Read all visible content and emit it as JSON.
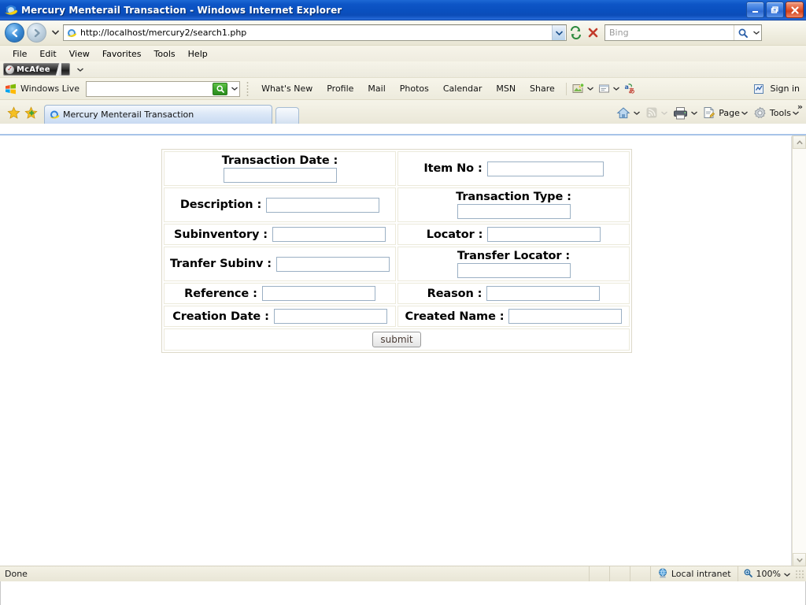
{
  "window": {
    "title": "Mercury Menterail Transaction - Windows Internet Explorer",
    "app_icon": "internet-explorer-icon",
    "buttons": {
      "minimize": "_",
      "restore": "❐",
      "close": "✕"
    }
  },
  "address_bar": {
    "back_icon": "back-arrow-icon",
    "forward_icon": "forward-arrow-icon",
    "history_dropdown_icon": "chevron-down-icon",
    "favicon": "page-favicon",
    "url": "http://localhost/mercury2/search1.php",
    "url_dropdown_icon": "chevron-down-icon",
    "refresh_icon": "refresh-icon",
    "stop_icon": "stop-icon",
    "search_placeholder": "Bing",
    "search_go_icon": "magnifier-icon",
    "search_dropdown_icon": "chevron-down-icon"
  },
  "menu": {
    "items": [
      "File",
      "Edit",
      "View",
      "Favorites",
      "Tools",
      "Help"
    ]
  },
  "mcafee": {
    "label": "McAfee",
    "mark": "✓",
    "dropdown_icon": "chevron-down-icon"
  },
  "windows_live": {
    "logo_icon": "windows-flag-icon",
    "name": "Windows Live",
    "search_value": "",
    "search_go_icon": "magnifier-icon",
    "search_dropdown_icon": "chevron-down-icon",
    "links": [
      "What's New",
      "Profile",
      "Mail",
      "Photos",
      "Calendar",
      "MSN",
      "Share"
    ],
    "tool_icons": [
      "photo-upload-icon",
      "note-icon",
      "translate-icon"
    ],
    "signin_icon": "signin-icon",
    "signin_label": "Sign in"
  },
  "tabs": {
    "favorites_icon": "star-icon",
    "add-favorites_icon": "star-plus-icon",
    "items": [
      {
        "label": "Mercury Menterail Transaction",
        "icon": "internet-explorer-icon",
        "active": true
      }
    ],
    "new_tab_icon": "new-tab-icon"
  },
  "command_bar": {
    "home_label": "Home",
    "home_icon": "home-icon",
    "feeds_icon": "rss-icon",
    "print_icon": "printer-icon",
    "page_label": "Page",
    "page_icon": "page-icon",
    "tools_label": "Tools",
    "tools_icon": "gear-icon",
    "overflow_icon": "double-chevron-icon"
  },
  "form": {
    "rows": [
      {
        "left": {
          "label": "Transaction Date :",
          "value": "",
          "name": "transaction-date",
          "layout": "stacked",
          "input_width": 144
        },
        "right": {
          "label": "Item No :",
          "value": "",
          "name": "item-no",
          "layout": "inline",
          "input_width": 148
        }
      },
      {
        "left": {
          "label": "Description :",
          "value": "",
          "name": "description",
          "layout": "inline",
          "input_width": 144
        },
        "right": {
          "label": "Transaction Type :",
          "value": "",
          "name": "transaction-type",
          "layout": "stacked",
          "input_width": 144
        }
      },
      {
        "left": {
          "label": "Subinventory :",
          "value": "",
          "name": "subinventory",
          "layout": "inline",
          "input_width": 144
        },
        "right": {
          "label": "Locator :",
          "value": "",
          "name": "locator",
          "layout": "inline",
          "input_width": 144
        }
      },
      {
        "left": {
          "label": "Tranfer Subinv :",
          "value": "",
          "name": "transfer-subinv",
          "layout": "inline",
          "input_width": 144
        },
        "right": {
          "label": "Transfer Locator :",
          "value": "",
          "name": "transfer-locator",
          "layout": "stacked",
          "input_width": 144
        }
      },
      {
        "left": {
          "label": "Reference :",
          "value": "",
          "name": "reference",
          "layout": "inline",
          "input_width": 144
        },
        "right": {
          "label": "Reason :",
          "value": "",
          "name": "reason",
          "layout": "inline",
          "input_width": 144
        }
      },
      {
        "left": {
          "label": "Creation Date :",
          "value": "",
          "name": "creation-date",
          "layout": "inline",
          "input_width": 144
        },
        "right": {
          "label": "Created Name :",
          "value": "",
          "name": "created-name",
          "layout": "inline",
          "input_width": 144
        }
      }
    ],
    "submit_label": "submit"
  },
  "status_bar": {
    "status": "Done",
    "zone_icon": "globe-icon",
    "zone": "Local intranet",
    "zoom_icon": "magnifier-icon",
    "zoom": "100%",
    "zoom_dropdown_icon": "chevron-down-icon"
  },
  "colors": {
    "titlebar_blue": "#0d55c6",
    "chrome_beige": "#f1efe2",
    "input_border": "#9bb0c4",
    "page_bg": "#ffffff"
  }
}
